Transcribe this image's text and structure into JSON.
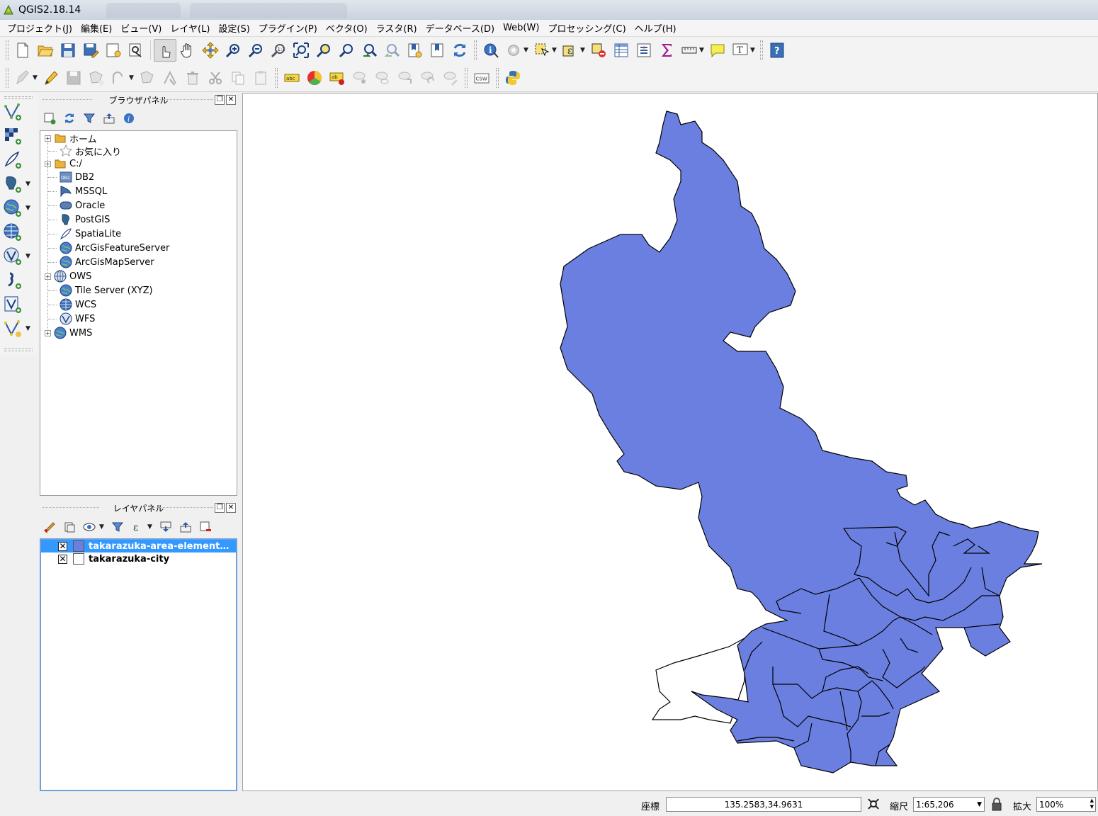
{
  "window": {
    "title": "QGIS2.18.14"
  },
  "menu": [
    "プロジェクト(J)",
    "編集(E)",
    "ビュー(V)",
    "レイヤ(L)",
    "設定(S)",
    "プラグイン(P)",
    "ベクタ(O)",
    "ラスタ(R)",
    "データベース(D)",
    "Web(W)",
    "プロセッシング(C)",
    "ヘルプ(H)"
  ],
  "toolbar2": {
    "csw_label": "CSW"
  },
  "browser_panel": {
    "title": "ブラウザパネル",
    "items": [
      {
        "label": "ホーム",
        "icon": "folder-icon",
        "expandable": true
      },
      {
        "label": "お気に入り",
        "icon": "star-icon",
        "expandable": false
      },
      {
        "label": "C:/",
        "icon": "folder-icon",
        "expandable": true
      },
      {
        "label": "DB2",
        "icon": "db2-icon",
        "expandable": false
      },
      {
        "label": "MSSQL",
        "icon": "mssql-icon",
        "expandable": false
      },
      {
        "label": "Oracle",
        "icon": "oracle-icon",
        "expandable": false
      },
      {
        "label": "PostGIS",
        "icon": "postgis-icon",
        "expandable": false
      },
      {
        "label": "SpatiaLite",
        "icon": "spatialite-icon",
        "expandable": false
      },
      {
        "label": "ArcGisFeatureServer",
        "icon": "arcgis-feature-icon",
        "expandable": false
      },
      {
        "label": "ArcGisMapServer",
        "icon": "arcgis-map-icon",
        "expandable": false
      },
      {
        "label": "OWS",
        "icon": "ows-icon",
        "expandable": true
      },
      {
        "label": "Tile Server (XYZ)",
        "icon": "globe-icon",
        "expandable": false
      },
      {
        "label": "WCS",
        "icon": "wcs-icon",
        "expandable": false
      },
      {
        "label": "WFS",
        "icon": "wfs-icon",
        "expandable": false
      },
      {
        "label": "WMS",
        "icon": "wms-icon",
        "expandable": true
      }
    ]
  },
  "layer_panel": {
    "title": "レイヤパネル",
    "layers": [
      {
        "name": "takarazuka-area-element…",
        "checked": true,
        "selected": true,
        "fill": "#6b7fe0"
      },
      {
        "name": "takarazuka-city",
        "checked": true,
        "selected": false,
        "fill": "#ffffff"
      }
    ]
  },
  "map": {
    "fill_color": "#6b7fe0",
    "outline_color": "#000000"
  },
  "statusbar": {
    "coord_label": "座標",
    "coord_value": "135.2583,34.9631",
    "scale_label": "縮尺",
    "scale_value": "1:65,206",
    "magnify_label": "拡大",
    "magnify_value": "100%"
  }
}
